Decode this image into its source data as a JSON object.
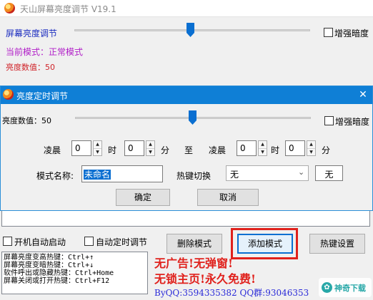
{
  "main_window": {
    "title": "天山屏幕亮度调节 V19.1",
    "brightness_label": "屏幕亮度调节",
    "brightness_level": 0.5,
    "enhance_dark_label": "增强暗度",
    "enhance_dark_checked": false,
    "current_mode_text": "当前模式：正常模式",
    "brightness_value_text": "亮度数值：50",
    "autostart_label": "开机自动启动",
    "auto_timer_label": "自动定时调节",
    "delete_mode_button": "删除模式",
    "add_mode_button": "添加模式",
    "hotkey_settings_button": "热键设置",
    "hotkey_info": [
      "屏幕亮度变高热键：Ctrl+↑",
      "屏幕亮度变暗热键：Ctrl+↓",
      "软件呼出或隐藏热键：Ctrl+Home",
      "屏幕关闭或打开热键：Ctrl+F12"
    ],
    "promo_line1": "无广告!无弹窗!",
    "promo_line2": "无锁主页!永久免费!",
    "contact": "ByQQ:3594335382 QQ群:93046353",
    "watermark": "神奇下载"
  },
  "dialog": {
    "title": "亮度定时调节",
    "close_glyph": "✕",
    "brightness_value_label": "亮度数值：50",
    "brightness_level": 0.5,
    "enhance_dark_label": "增强暗度",
    "enhance_dark_checked": false,
    "start_label": "凌晨",
    "start_hour": "0",
    "hour_unit": "时",
    "start_minute": "0",
    "minute_unit": "分",
    "to_label": "至",
    "end_label": "凌晨",
    "end_hour": "0",
    "end_minute": "0",
    "mode_name_label": "模式名称:",
    "mode_name_value": "未命名",
    "hotkey_switch_label": "热键切换",
    "hotkey_select_value": "无",
    "hotkey_key_value": "无",
    "ok_button": "确定",
    "cancel_button": "取消"
  },
  "colors": {
    "accent_blue": "#0f7fd6",
    "current_mode_purple": "#b11ec8",
    "brightness_value_red": "#d0242a",
    "highlight_red": "#e0211c",
    "contact_blue": "#2a2ad8"
  },
  "icons": {
    "app": "app-logo-icon",
    "close": "close-icon",
    "spin_up": "arrow-up-icon",
    "spin_down": "arrow-down-icon",
    "dropdown": "chevron-down-icon"
  }
}
